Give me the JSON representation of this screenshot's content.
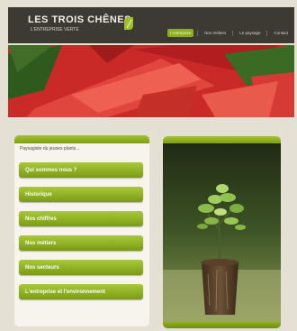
{
  "header": {
    "logo_title": "LES TROIS CHÊNES",
    "logo_tagline": "L'ENTREPRISE VERTE",
    "nav": [
      "L'entreprise",
      "Nos métiers",
      "Le paysage",
      "Contact"
    ]
  },
  "sidebar": {
    "intro": "Paysagiste du jeunes plants...",
    "items": [
      "Qui sommes nous ?",
      "Historique",
      "Nos chiffres",
      "Nos métiers",
      "Nos secteurs",
      "L'entreprise et l'environnement"
    ]
  },
  "colors": {
    "header": "#3d3a33",
    "accent": "#8cae1c",
    "page_bg": "#e4e0d3"
  }
}
